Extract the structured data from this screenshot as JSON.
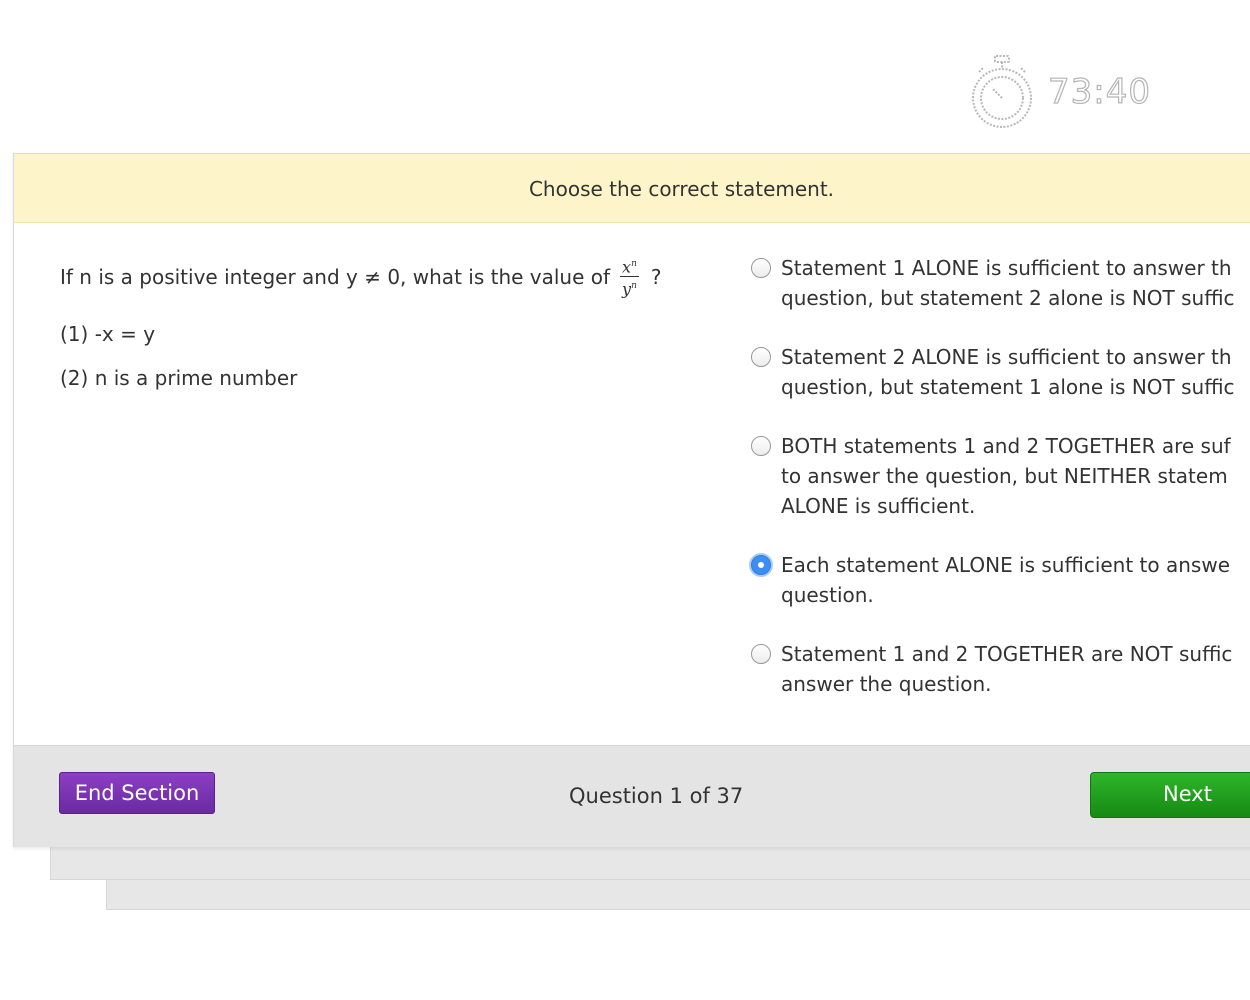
{
  "timer": {
    "icon": "stopwatch-icon",
    "time": "73:40"
  },
  "question": {
    "instruction": "Choose the correct statement.",
    "stem_prefix": "If n is a positive integer and y ≠ 0, what is the value of",
    "fraction": {
      "numerator": "x",
      "denominator": "y",
      "exponent": "n"
    },
    "stem_suffix": "?",
    "statement_1": "(1) -x = y",
    "statement_2": "(2) n is a prime number"
  },
  "options": [
    {
      "lines": [
        "Statement 1 ALONE is sufficient to answer th",
        "question, but statement 2 alone is NOT suffic"
      ],
      "selected": false
    },
    {
      "lines": [
        "Statement 2 ALONE is sufficient to answer th",
        "question, but statement 1 alone is NOT suffic"
      ],
      "selected": false
    },
    {
      "lines": [
        "BOTH statements 1 and 2 TOGETHER are suf",
        "to answer the question, but NEITHER statem",
        "ALONE is sufficient."
      ],
      "selected": false
    },
    {
      "lines": [
        "Each statement ALONE is sufficient to answe",
        "question."
      ],
      "selected": true
    },
    {
      "lines": [
        "Statement 1 and 2 TOGETHER are NOT suffic",
        "answer the question."
      ],
      "selected": false
    }
  ],
  "footer": {
    "end_section_label": "End Section",
    "question_counter": "Question 1 of 37",
    "next_label": "Next"
  },
  "colors": {
    "instruction_bg": "#fdf5c9",
    "end_button": "#7a35b5",
    "next_button": "#22a01d",
    "radio_selected": "#3d8ef0"
  }
}
